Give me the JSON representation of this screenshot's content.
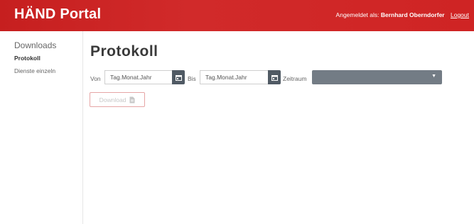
{
  "header": {
    "brand": "HÄND Portal",
    "logged_in_label": "Angemeldet als:",
    "user_name": "Bernhard Oberndorfer",
    "logout_label": "Logout"
  },
  "sidebar": {
    "items": [
      {
        "label": "Downloads"
      },
      {
        "label": "Protokoll",
        "active": true
      },
      {
        "label": "Dienste einzeln"
      }
    ]
  },
  "main": {
    "title": "Protokoll",
    "from_label": "Von",
    "from_placeholder": "Tag.Monat.Jahr",
    "to_label": "Bis",
    "to_placeholder": "Tag.Monat.Jahr",
    "period_label": "Zeitraum",
    "period_value": "",
    "download_label": "Download"
  },
  "icons": {
    "from_picker": "calendar-icon",
    "to_picker": "calendar-icon",
    "period_dropdown": "caret-down-icon",
    "download": "file-icon"
  },
  "colors": {
    "header_bg": "#c9201f",
    "picker_button": "#505a64",
    "select_bg": "#737c85",
    "download_border": "#e6a5a5"
  }
}
